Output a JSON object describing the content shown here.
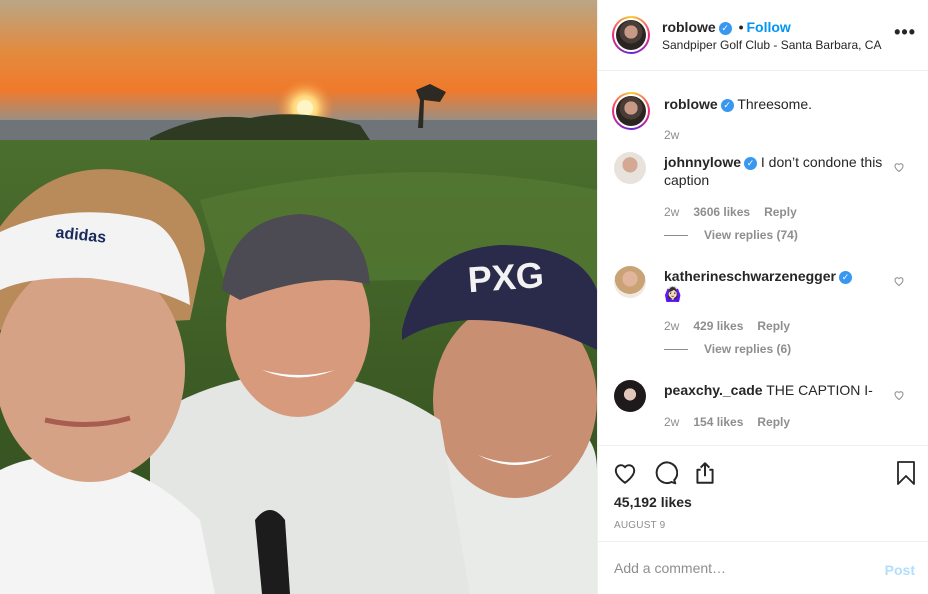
{
  "post": {
    "photo_description_icon": "selfie-photo",
    "header": {
      "username": "roblowe",
      "separator": "•",
      "follow_label": "Follow",
      "location": "Sandpiper Golf Club - Santa Barbara, CA",
      "more_label": "•••"
    },
    "caption": {
      "username": "roblowe",
      "text": "Threesome.",
      "age": "2w"
    },
    "comments": [
      {
        "username": "johnnylowe",
        "text": "I don’t condone this caption",
        "age": "2w",
        "likes": "3606 likes",
        "reply_label": "Reply",
        "view_replies": "View replies (74)"
      },
      {
        "username": "katherineschwarzenegger",
        "text": "🙆🏻‍♀️",
        "age": "2w",
        "likes": "429 likes",
        "reply_label": "Reply",
        "view_replies": "View replies (6)"
      },
      {
        "username": "peaxchy._cade",
        "text": "THE CAPTION I-",
        "age": "2w",
        "likes": "154 likes",
        "reply_label": "Reply"
      }
    ],
    "likes": "45,192 likes",
    "date": "AUGUST 9",
    "comment_placeholder": "Add a comment…",
    "post_label": "Post",
    "colors": {
      "accent": "#0095f6",
      "verified": "#3897f0",
      "muted": "#8e8e8e",
      "post_disabled": "#b2dffc"
    }
  }
}
